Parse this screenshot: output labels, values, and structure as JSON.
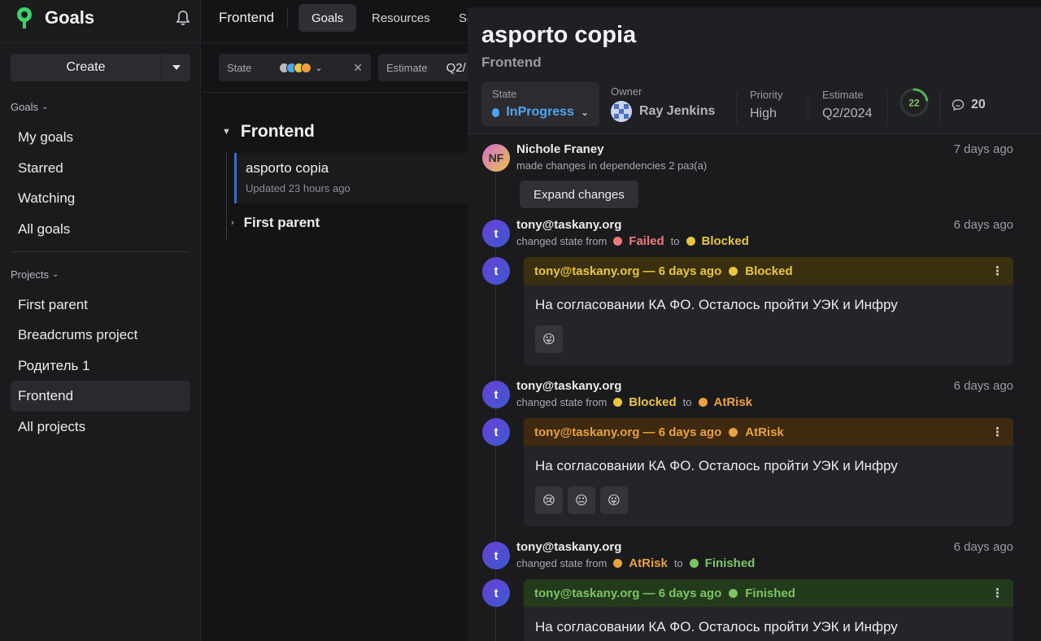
{
  "app": {
    "title": "Goals"
  },
  "sidebar": {
    "create_label": "Create",
    "goals_section": "Goals",
    "goals_items": [
      "My goals",
      "Starred",
      "Watching",
      "All goals"
    ],
    "projects_section": "Projects",
    "projects_items": [
      "First parent",
      "Breadcrums project",
      "Родитель 1",
      "Frontend",
      "All projects"
    ],
    "active_project": "Frontend"
  },
  "topbar": {
    "project": "Frontend",
    "tabs": [
      "Goals",
      "Resources",
      "Se"
    ],
    "active_tab": "Goals"
  },
  "filters": {
    "state_label": "State",
    "state_colors": [
      "#b9b9c0",
      "#4ea6f0",
      "#e9c63f",
      "#eba23d"
    ],
    "estimate_label": "Estimate",
    "estimate_value": "Q2/"
  },
  "list": {
    "group": "Frontend",
    "goal_title": "asporto copia",
    "goal_updated": "Updated 23 hours ago",
    "sub_group": "First parent"
  },
  "preview": {
    "title": "asporto copia",
    "project": "Frontend",
    "state_label": "State",
    "state_value": "InProgress",
    "owner_label": "Owner",
    "owner_value": "Ray Jenkins",
    "priority_label": "Priority",
    "priority_value": "High",
    "estimate_label": "Estimate",
    "estimate_value": "Q2/2024",
    "progress": "22",
    "progress_fraction": 0.22,
    "comments_count": "20"
  },
  "activity": {
    "e1": {
      "avatar": "NF",
      "author": "Nichole Franey",
      "text": "made changes in dependencies 2 раз(a)",
      "time": "7 days ago",
      "button": "Expand changes"
    },
    "e2": {
      "avatar": "t",
      "author": "tony@taskany.org",
      "text": "changed state from",
      "from": "Failed",
      "to_word": "to",
      "to": "Blocked",
      "time": "6 days ago"
    },
    "c1": {
      "avatar": "t",
      "head": "tony@taskany.org — 6 days ago",
      "state": "Blocked",
      "body": "На согласовании КА ФО. Осталось пройти УЭК и Инфру",
      "reactions": [
        "😛"
      ]
    },
    "e3": {
      "avatar": "t",
      "author": "tony@taskany.org",
      "text": "changed state from",
      "from": "Blocked",
      "to_word": "to",
      "to": "AtRisk",
      "time": "6 days ago"
    },
    "c2": {
      "avatar": "t",
      "head": "tony@taskany.org — 6 days ago",
      "state": "AtRisk",
      "body": "На согласовании КА ФО. Осталось пройти УЭК и Инфру",
      "reactions": [
        "😢",
        "😐",
        "😛"
      ]
    },
    "e4": {
      "avatar": "t",
      "author": "tony@taskany.org",
      "text": "changed state from",
      "from": "AtRisk",
      "to_word": "to",
      "to": "Finished",
      "time": "6 days ago"
    },
    "c3": {
      "avatar": "t",
      "head": "tony@taskany.org — 6 days ago",
      "state": "Finished",
      "body": "На согласовании КА ФО. Осталось пройти УЭК и Инфру"
    }
  },
  "colors": {
    "blocked": "#e9c63f",
    "failed": "#f07a7a",
    "atrisk": "#eba23d",
    "finished": "#7cc462",
    "inprogress": "#4ea6f0",
    "blocked_header_bg": "#3a300f",
    "atrisk_header_bg": "#3d2a10",
    "finished_header_bg": "#233a1c"
  }
}
